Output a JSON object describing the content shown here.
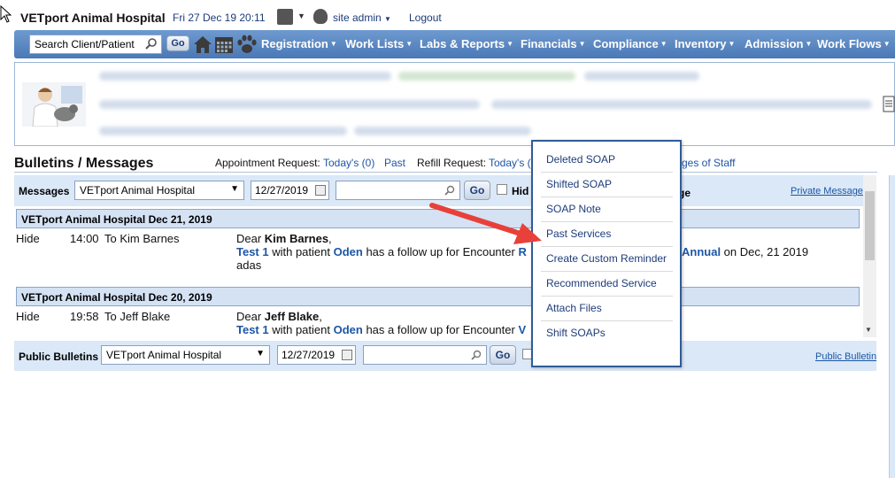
{
  "header": {
    "hospital_name": "VETport Animal Hospital",
    "datetime": "Fri 27 Dec 19 20:11",
    "user_menu": "site admin",
    "logout": "Logout"
  },
  "nav": {
    "search_placeholder": "Search Client/Patient",
    "go": "Go",
    "items": [
      "Registration",
      "Work Lists",
      "Labs & Reports",
      "Financials",
      "Compliance",
      "Inventory",
      "Admission",
      "Work Flows"
    ]
  },
  "bulletins": {
    "title": "Bulletins / Messages",
    "appointment_request_label": "Appointment Request:",
    "appointment_today": "Today's (0)",
    "appointment_past": "Past",
    "refill_request_label": "Refill Request:",
    "refill_today": "Today's (",
    "staff_link": "ges of Staff"
  },
  "messages": {
    "label": "Messages",
    "hospital_select": "VETport Animal Hospital",
    "date": "12/27/2019",
    "go": "Go",
    "hide_label": "Hid",
    "ge_label": "ge",
    "private_message": "Private Message",
    "days": [
      {
        "header": "VETport Animal Hospital  Dec 21, 2019",
        "hide": "Hide",
        "time": "14:00",
        "to": "To Kim Barnes",
        "greeting_prefix": "Dear ",
        "greeting_name": "Kim Barnes",
        "greeting_suffix": ",",
        "line_link1": "Test 1",
        "line_mid1": " with patient ",
        "line_link2": "Oden",
        "line_mid2": " has a follow up for Encounter ",
        "line_hidden_start": "R",
        "line_link3": "Annual",
        "line_tail": " on Dec, 21 2019",
        "body": "adas"
      },
      {
        "header": "VETport Animal Hospital  Dec 20, 2019",
        "hide": "Hide",
        "time": "19:58",
        "to": "To Jeff Blake",
        "greeting_prefix": "Dear ",
        "greeting_name": "Jeff Blake",
        "greeting_suffix": ",",
        "line_link1": "Test 1",
        "line_mid1": " with patient ",
        "line_link2": "Oden",
        "line_mid2": " has a follow up for Encounter ",
        "line_hidden_start": "V"
      }
    ]
  },
  "public_bulletins": {
    "label": "Public Bulletins",
    "hospital_select": "VETport Animal Hospital",
    "date": "12/27/2019",
    "go": "Go",
    "link": "Public Bulletin"
  },
  "dropdown_menu": {
    "items": [
      "Deleted SOAP",
      "Shifted SOAP",
      "SOAP Note",
      "Past Services",
      "Create Custom Reminder",
      "Recommended Service",
      "Attach Files",
      "Shift SOAPs"
    ]
  },
  "colors": {
    "nav_bar": "#5a86c2",
    "link": "#1c56a6",
    "panel_bg": "#dbe8f7",
    "arrow": "#e8413a"
  }
}
